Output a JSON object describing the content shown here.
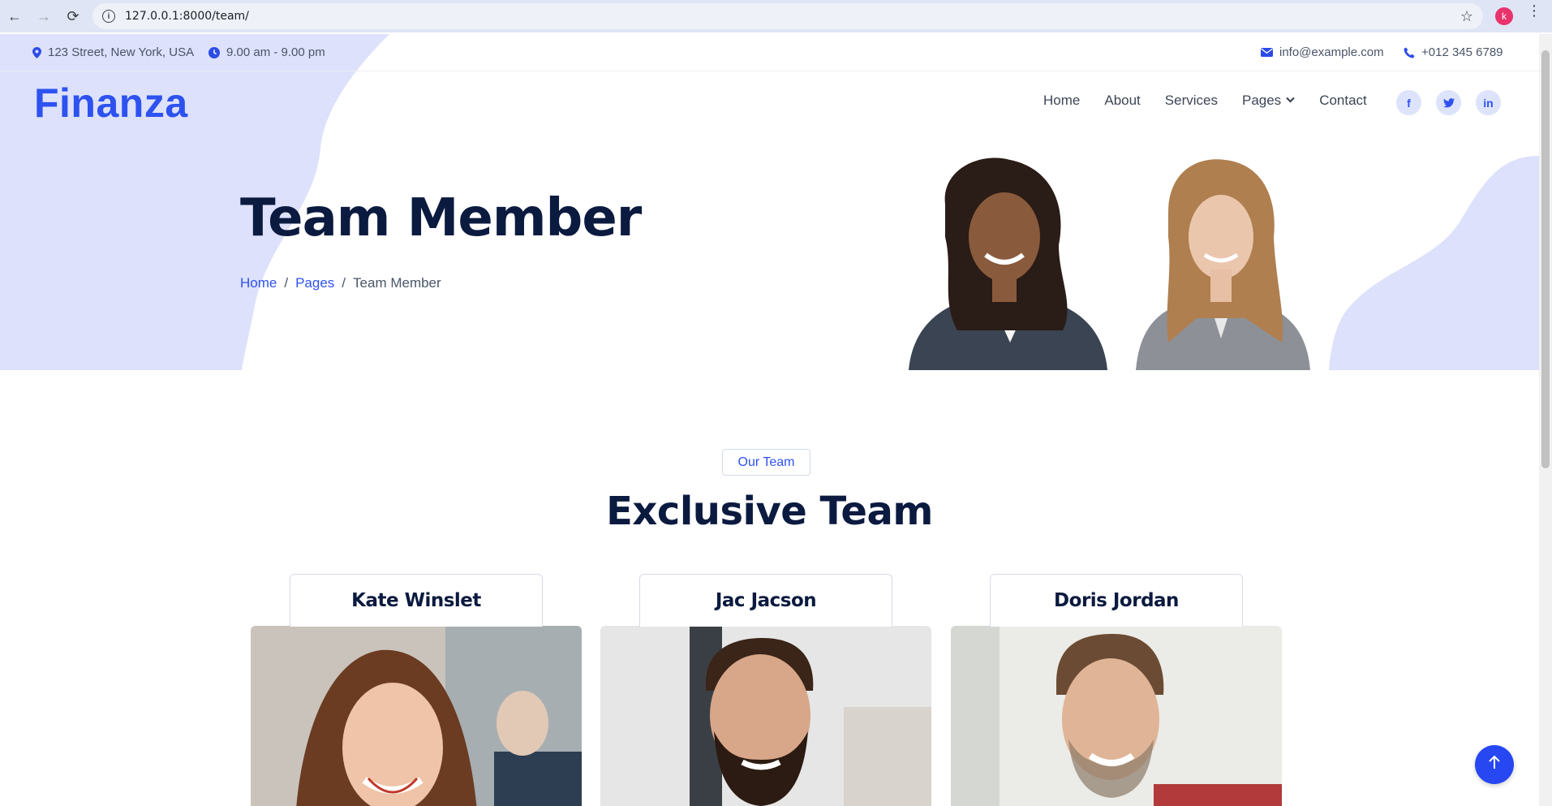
{
  "browser": {
    "url": "127.0.0.1:8000/team/",
    "profile_initial": "k"
  },
  "topbar": {
    "address": "123 Street, New York, USA",
    "hours": "9.00 am - 9.00 pm",
    "email": "info@example.com",
    "phone": "+012 345 6789"
  },
  "brand": {
    "logo": "Finanza",
    "accent": "#2e52f0",
    "dark": "#0b1a3f",
    "blob": "#dde1fb"
  },
  "nav": {
    "items": [
      {
        "label": "Home"
      },
      {
        "label": "About"
      },
      {
        "label": "Services"
      },
      {
        "label": "Pages"
      },
      {
        "label": "Contact"
      }
    ],
    "social": [
      {
        "icon": "facebook-icon",
        "glyph": "f"
      },
      {
        "icon": "twitter-icon",
        "glyph": "t"
      },
      {
        "icon": "linkedin-icon",
        "glyph": "in"
      }
    ]
  },
  "hero": {
    "title": "Team Member",
    "breadcrumb": [
      "Home",
      "Pages",
      "Team Member"
    ]
  },
  "team": {
    "badge": "Our Team",
    "title": "Exclusive Team",
    "members": [
      {
        "name": "Kate Winslet"
      },
      {
        "name": "Jac Jacson"
      },
      {
        "name": "Doris Jordan"
      }
    ]
  }
}
